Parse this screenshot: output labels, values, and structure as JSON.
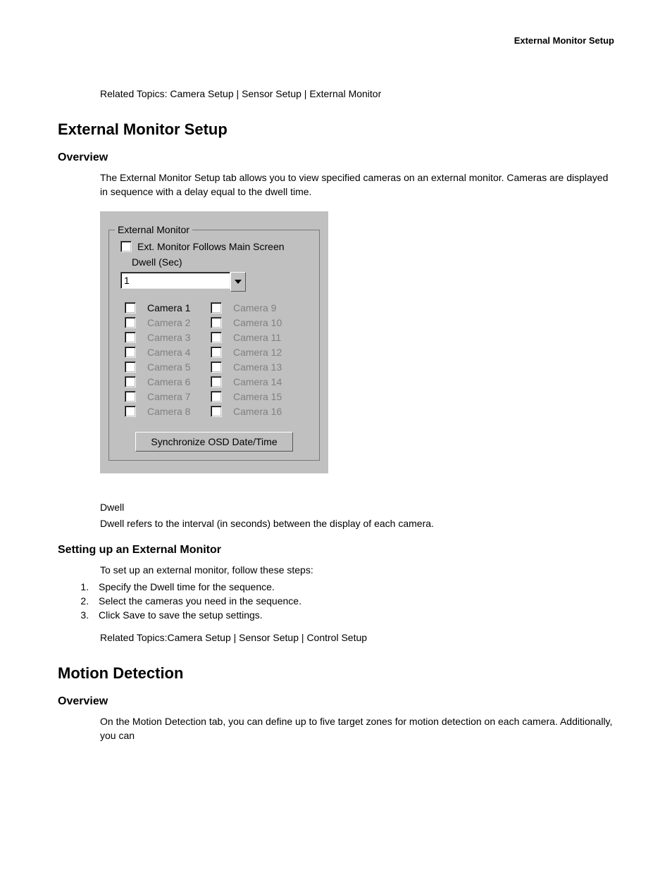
{
  "header": {
    "title": "External Monitor Setup"
  },
  "related_top": {
    "prefix": "Related Topics: ",
    "links": [
      "Camera Setup",
      "Sensor Setup",
      "External Monitor"
    ]
  },
  "section1": {
    "title": "External Monitor Setup",
    "overview_h": "Overview",
    "overview_p": "The External Monitor Setup tab allows you to view specified cameras on an external monitor. Cameras are displayed in sequence with a delay equal to the dwell time."
  },
  "dialog": {
    "legend": "External Monitor",
    "follows": "Ext. Monitor Follows Main Screen",
    "dwell_label": "Dwell (Sec)",
    "dwell_value": "1",
    "cameras_left": [
      {
        "label": "Camera 1",
        "enabled": true
      },
      {
        "label": "Camera 2",
        "enabled": false
      },
      {
        "label": "Camera 3",
        "enabled": false
      },
      {
        "label": "Camera 4",
        "enabled": false
      },
      {
        "label": "Camera 5",
        "enabled": false
      },
      {
        "label": "Camera 6",
        "enabled": false
      },
      {
        "label": "Camera 7",
        "enabled": false
      },
      {
        "label": "Camera 8",
        "enabled": false
      }
    ],
    "cameras_right": [
      {
        "label": "Camera 9",
        "enabled": false
      },
      {
        "label": "Camera 10",
        "enabled": false
      },
      {
        "label": "Camera 11",
        "enabled": false
      },
      {
        "label": "Camera 12",
        "enabled": false
      },
      {
        "label": "Camera 13",
        "enabled": false
      },
      {
        "label": "Camera 14",
        "enabled": false
      },
      {
        "label": "Camera 15",
        "enabled": false
      },
      {
        "label": "Camera 16",
        "enabled": false
      }
    ],
    "sync_btn": "Synchronize OSD Date/Time"
  },
  "dwell_term": {
    "term": "Dwell",
    "def": "Dwell refers to the interval (in seconds) between the display of each camera."
  },
  "setup": {
    "h": "Setting up an External Monitor",
    "intro": "To set up an external monitor, follow these steps:",
    "steps": [
      "Specify the Dwell time for the sequence.",
      "Select the cameras you need in the sequence.",
      "Click Save to save the setup settings."
    ]
  },
  "related_bottom": {
    "prefix": "Related Topics:",
    "links": [
      "Camera Setup",
      "Sensor Setup",
      "Control Setup"
    ]
  },
  "section2": {
    "title": "Motion Detection",
    "overview_h": "Overview",
    "overview_p": "On the Motion Detection tab, you can define up to five target zones for motion detection on each camera. Additionally, you can"
  }
}
